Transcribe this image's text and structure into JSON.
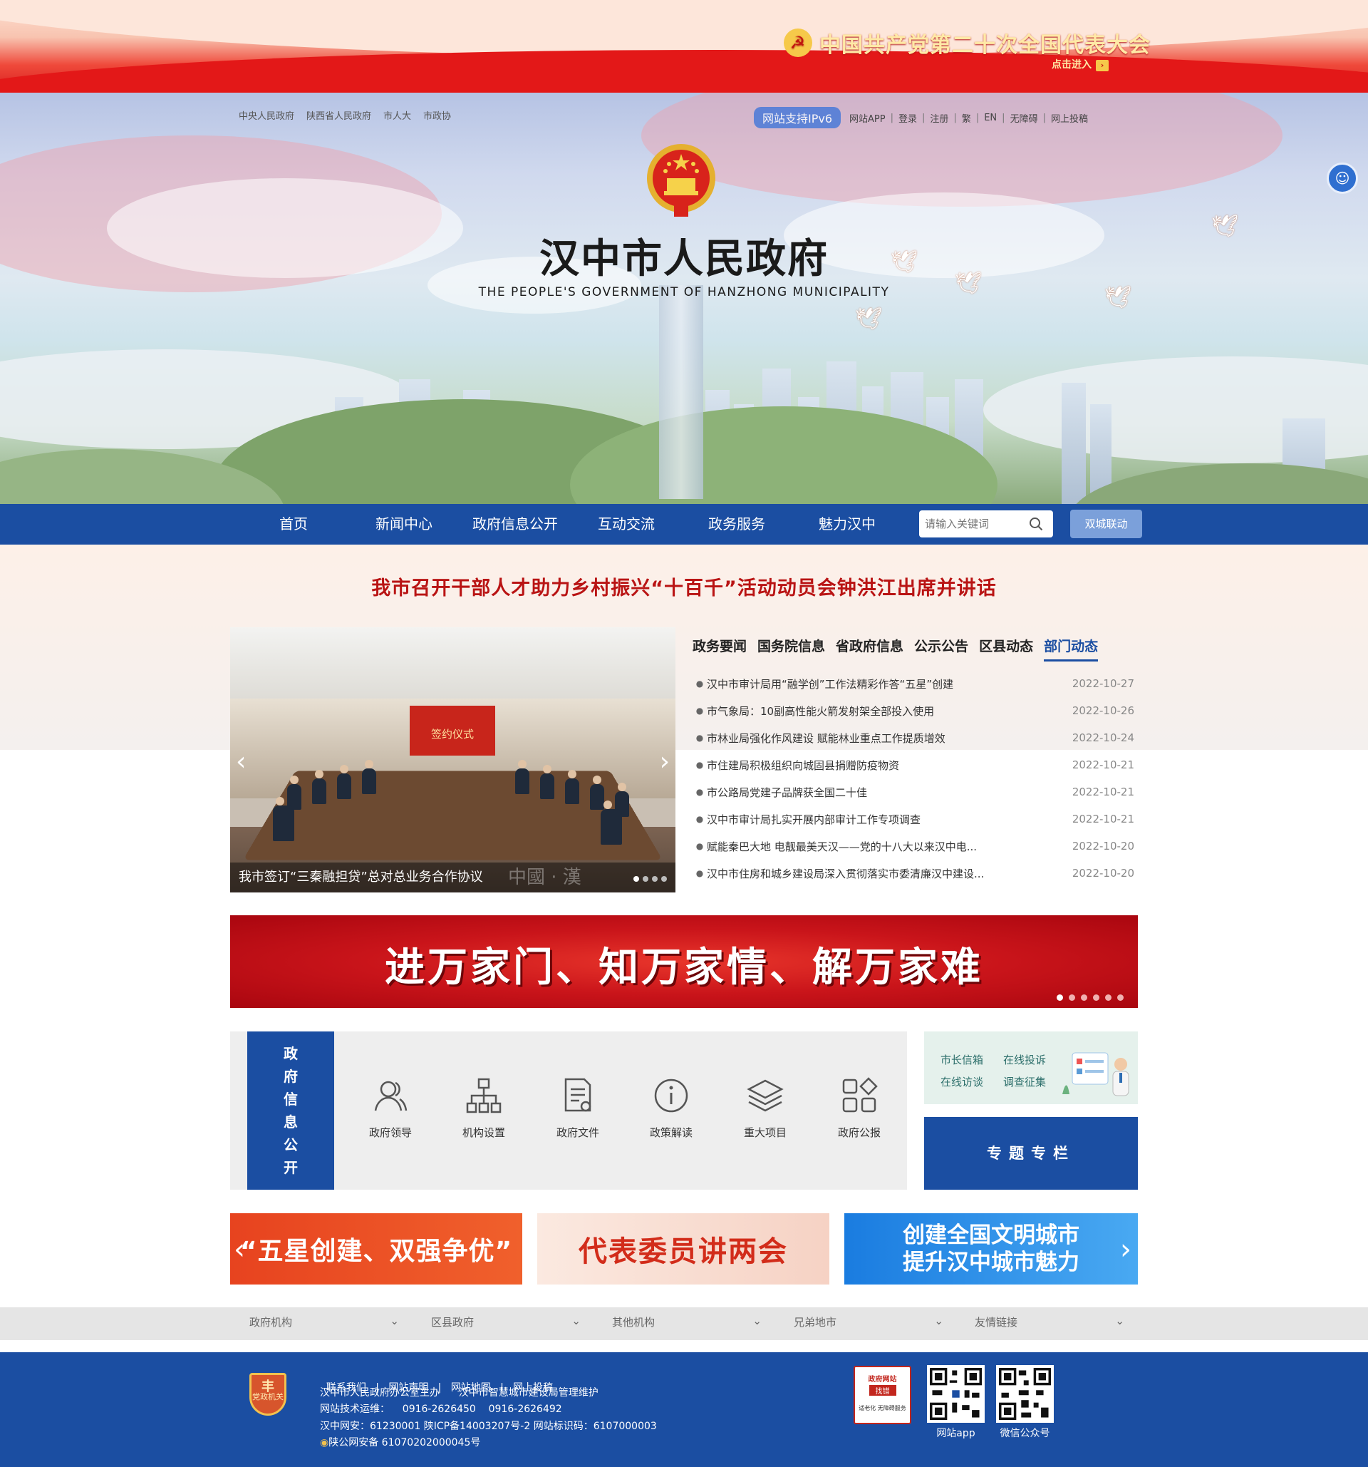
{
  "party_banner": {
    "title": "中国共产党第二十次全国代表大会",
    "enter": "点击进入"
  },
  "top_links_left": [
    "中央人民政府",
    "陕西省人民政府",
    "市人大",
    "市政协"
  ],
  "top_links_right": {
    "ipv6": "网站支持IPv6",
    "items": [
      "网站APP",
      "登录",
      "注册",
      "繁",
      "EN",
      "无障碍",
      "网上投稿"
    ]
  },
  "site": {
    "title": "汉中市人民政府",
    "subtitle": "THE PEOPLE'S GOVERNMENT OF HANZHONG MUNICIPALITY"
  },
  "nav": {
    "items": [
      "首页",
      "新闻中心",
      "政府信息公开",
      "互动交流",
      "政务服务",
      "魅力汉中"
    ],
    "search_placeholder": "请输入关键词",
    "dual_button": "双城联动"
  },
  "headline": "我市召开干部人才助力乡村振兴“十百千”活动动员会钟洪江出席并讲话",
  "carousel": {
    "caption": "我市签订“三秦融担贷”总对总业务合作协议",
    "slide_text": "签约仪式",
    "watermark": "中國 · 漢"
  },
  "news_tabs": [
    "政务要闻",
    "国务院信息",
    "省政府信息",
    "公示公告",
    "区县动态",
    "部门动态"
  ],
  "news_active_tab": 5,
  "news": [
    {
      "title": "汉中市审计局用“融学创”工作法精彩作答“五星”创建",
      "date": "2022-10-27"
    },
    {
      "title": "市气象局：10副高性能火箭发射架全部投入使用",
      "date": "2022-10-26"
    },
    {
      "title": "市林业局强化作风建设 赋能林业重点工作提质增效",
      "date": "2022-10-24"
    },
    {
      "title": "市住建局积极组织向城固县捐赠防疫物资",
      "date": "2022-10-21"
    },
    {
      "title": "市公路局党建子品牌获全国二十佳",
      "date": "2022-10-21"
    },
    {
      "title": "汉中市审计局扎实开展内部审计工作专项调查",
      "date": "2022-10-21"
    },
    {
      "title": "赋能秦巴大地 电靓最美天汉——党的十八大以来汉中电...",
      "date": "2022-10-20"
    },
    {
      "title": "汉中市住房和城乡建设局深入贯彻落实市委清廉汉中建设...",
      "date": "2022-10-20"
    }
  ],
  "banner": {
    "text": "进万家门、知万家情、解万家难"
  },
  "info_disclosure": {
    "label": [
      "政",
      "府",
      "信",
      "息",
      "公",
      "开"
    ],
    "items": [
      "政府领导",
      "机构设置",
      "政府文件",
      "政策解读",
      "重大项目",
      "政府公报"
    ]
  },
  "mayor_box": {
    "links": [
      "市长信箱",
      "在线投诉",
      "在线访谈",
      "调查征集"
    ]
  },
  "special_column": "专题专栏",
  "promos": {
    "p1": "“五星创建、双强争优”",
    "p2": "代表委员讲两会",
    "p3_line1": "创建全国文明城市",
    "p3_line2": "提升汉中城市魅力"
  },
  "link_selects": [
    "政府机构",
    "区县政府",
    "其他机构",
    "兄弟地市",
    "友情链接"
  ],
  "footer": {
    "links": [
      "联系我们",
      "网站声明",
      "网站地图",
      "网上投稿"
    ],
    "host": "汉中市人民政府办公室主办      汉中市智慧城市建设局管理维护",
    "support": "网站技术运维：    0916-2626450    0916-2626492",
    "icp": "汉中网安：61230001 陕ICP备14003207号-2 网站标识码：6107000003",
    "police": "陕公网安备 61070202000045号",
    "party_org": "党政机关",
    "badge": {
      "top": "政府网站",
      "mid": "找错",
      "bot": "适老化 无障碍服务"
    },
    "qr_app": "网站app",
    "qr_wechat": "微信公众号"
  }
}
